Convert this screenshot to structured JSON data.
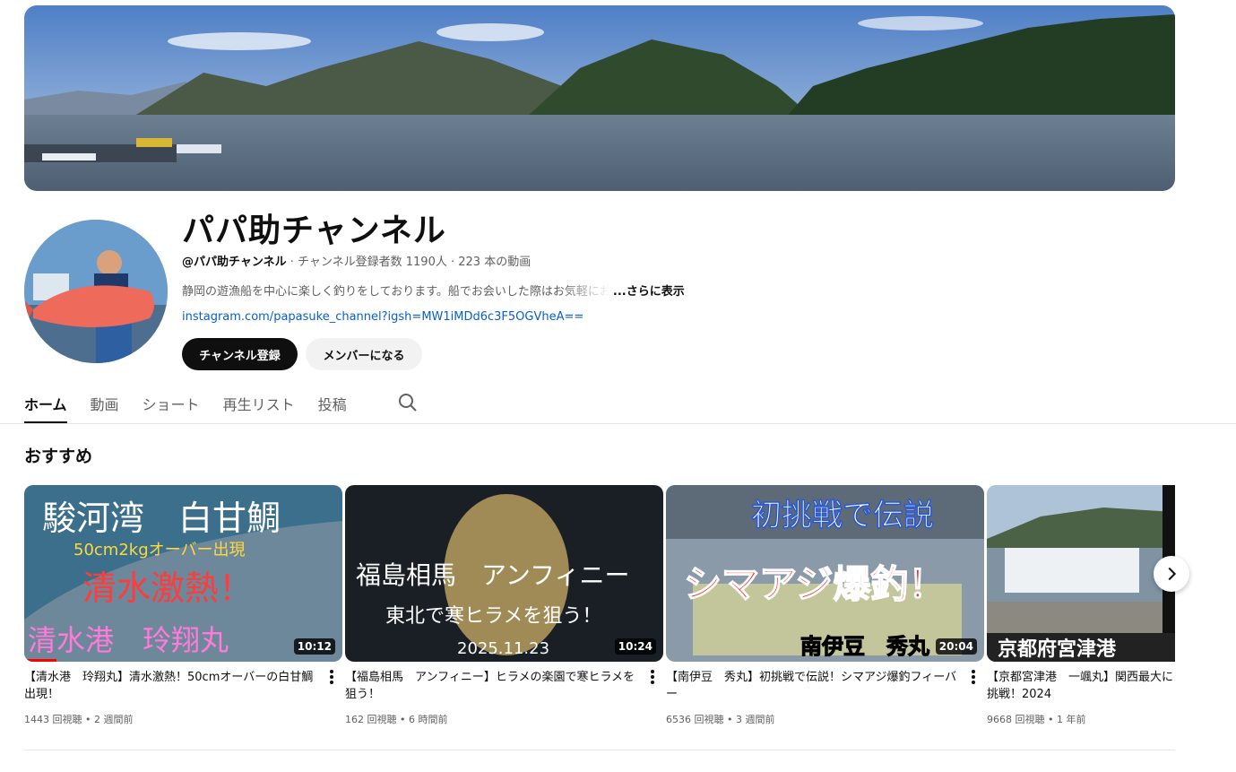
{
  "channel": {
    "name": "パパ助チャンネル",
    "handle": "@パパ助チャンネル",
    "meta": " · チャンネル登録者数 1190人 · 223 本の動画",
    "description": "静岡の遊漁船を中心に楽しく釣りをしております。船でお会いした際はお気軽にお",
    "more_label": "...さらに表示",
    "link": "instagram.com/papasuke_channel?igsh=MW1iMDd6c3F5OGVheA==",
    "subscribe_label": "チャンネル登録",
    "member_label": "メンバーになる"
  },
  "tabs": [
    {
      "label": "ホーム"
    },
    {
      "label": "動画"
    },
    {
      "label": "ショート"
    },
    {
      "label": "再生リスト"
    },
    {
      "label": "投稿"
    }
  ],
  "section": {
    "title": "おすすめ"
  },
  "videos": [
    {
      "title": "【清水港　玲翔丸】清水激熱！50cmオーバーの白甘鯛出現！",
      "meta": "1443 回視聴 • 2 週間前",
      "duration": "10:12",
      "watched_fraction": 0.1,
      "thumb_text": [
        "駿河湾　白甘鯛",
        "50cm2kgオーバー出現",
        "清水激熱！",
        "清水港　玲翔丸"
      ]
    },
    {
      "title": "【福島相馬　アンフィニー】ヒラメの楽園で寒ヒラメを狙う！",
      "meta": "162 回視聴 • 6 時間前",
      "duration": "10:24",
      "thumb_text": [
        "福島相馬　アンフィニー",
        "東北で寒ヒラメを狙う！",
        "2025.11.23"
      ]
    },
    {
      "title": "【南伊豆　秀丸】初挑戦で伝説！シマアジ爆釣フィーバー",
      "meta": "6536 回視聴 • 3 週間前",
      "duration": "20:04",
      "thumb_text": [
        "初挑戦で伝説",
        "シマアジ爆釣！",
        "南伊豆　秀丸"
      ]
    },
    {
      "title": "【京都宮津港　一颯丸】関西最大に挑戦！2024",
      "meta": "9668 回視聴 • 1 年前",
      "thumb_text": [
        "京都府宮津港"
      ]
    }
  ],
  "colors": {
    "accent": "#065fd4",
    "progress": "#ff0000",
    "subscribe_bg": "#0f0f0f",
    "member_bg": "#f2f2f2"
  },
  "icons": [
    "search-icon",
    "kebab-icon",
    "chevron-right-icon"
  ]
}
